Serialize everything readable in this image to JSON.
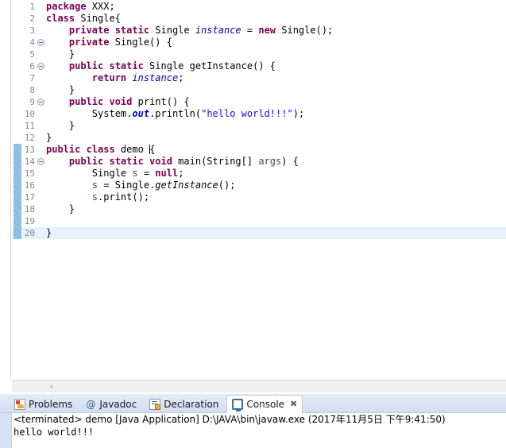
{
  "editor": {
    "name": "java-code-editor",
    "current_line": 20,
    "caret_line": 13,
    "changed_lines_from": 13,
    "changed_lines_to": 20,
    "horizontal_scroll_arrow": "‹",
    "lines": [
      {
        "num": "1",
        "fold": false,
        "changed": false,
        "current": false,
        "tokens": [
          {
            "t": "kw",
            "v": "package"
          },
          {
            "t": "plain",
            "v": " XXX;"
          }
        ]
      },
      {
        "num": "2",
        "fold": false,
        "changed": false,
        "current": false,
        "tokens": [
          {
            "t": "kw",
            "v": "class"
          },
          {
            "t": "plain",
            "v": " Single{"
          }
        ]
      },
      {
        "num": "3",
        "fold": false,
        "changed": false,
        "current": false,
        "tokens": [
          {
            "t": "plain",
            "v": "    "
          },
          {
            "t": "kw",
            "v": "private static"
          },
          {
            "t": "plain",
            "v": " Single "
          },
          {
            "t": "fld",
            "v": "instance"
          },
          {
            "t": "plain",
            "v": " = "
          },
          {
            "t": "kw",
            "v": "new"
          },
          {
            "t": "plain",
            "v": " Single();"
          }
        ]
      },
      {
        "num": "4",
        "fold": true,
        "changed": false,
        "current": false,
        "tokens": [
          {
            "t": "plain",
            "v": "    "
          },
          {
            "t": "kw",
            "v": "private"
          },
          {
            "t": "plain",
            "v": " Single() {"
          }
        ]
      },
      {
        "num": "5",
        "fold": false,
        "changed": false,
        "current": false,
        "tokens": [
          {
            "t": "plain",
            "v": "    }"
          }
        ]
      },
      {
        "num": "6",
        "fold": true,
        "changed": false,
        "current": false,
        "tokens": [
          {
            "t": "plain",
            "v": "    "
          },
          {
            "t": "kw",
            "v": "public static"
          },
          {
            "t": "plain",
            "v": " Single getInstance() {"
          }
        ]
      },
      {
        "num": "7",
        "fold": false,
        "changed": false,
        "current": false,
        "tokens": [
          {
            "t": "plain",
            "v": "        "
          },
          {
            "t": "kw",
            "v": "return"
          },
          {
            "t": "plain",
            "v": " "
          },
          {
            "t": "fld",
            "v": "instance"
          },
          {
            "t": "plain",
            "v": ";"
          }
        ]
      },
      {
        "num": "8",
        "fold": false,
        "changed": false,
        "current": false,
        "tokens": [
          {
            "t": "plain",
            "v": "    }"
          }
        ]
      },
      {
        "num": "9",
        "fold": true,
        "changed": false,
        "current": false,
        "tokens": [
          {
            "t": "plain",
            "v": "    "
          },
          {
            "t": "kw",
            "v": "public void"
          },
          {
            "t": "plain",
            "v": " print() {"
          }
        ]
      },
      {
        "num": "10",
        "fold": false,
        "changed": false,
        "current": false,
        "tokens": [
          {
            "t": "plain",
            "v": "        System."
          },
          {
            "t": "sfld",
            "v": "out"
          },
          {
            "t": "plain",
            "v": ".println("
          },
          {
            "t": "str",
            "v": "\"hello world!!!\""
          },
          {
            "t": "plain",
            "v": ");"
          }
        ]
      },
      {
        "num": "11",
        "fold": false,
        "changed": false,
        "current": false,
        "tokens": [
          {
            "t": "plain",
            "v": "    }"
          }
        ]
      },
      {
        "num": "12",
        "fold": false,
        "changed": false,
        "current": false,
        "tokens": [
          {
            "t": "plain",
            "v": "}"
          }
        ]
      },
      {
        "num": "13",
        "fold": false,
        "changed": true,
        "current": false,
        "caret_at_end": true,
        "tokens": [
          {
            "t": "kw",
            "v": "public class"
          },
          {
            "t": "plain",
            "v": " demo "
          },
          {
            "t": "plain",
            "v": "{"
          }
        ]
      },
      {
        "num": "14",
        "fold": true,
        "changed": true,
        "current": false,
        "tokens": [
          {
            "t": "plain",
            "v": "    "
          },
          {
            "t": "kw",
            "v": "public static void"
          },
          {
            "t": "plain",
            "v": " main(String[] "
          },
          {
            "t": "lvar",
            "v": "args"
          },
          {
            "t": "plain",
            "v": ") {"
          }
        ]
      },
      {
        "num": "15",
        "fold": false,
        "changed": true,
        "current": false,
        "tokens": [
          {
            "t": "plain",
            "v": "        Single "
          },
          {
            "t": "lvar",
            "v": "s"
          },
          {
            "t": "plain",
            "v": " = "
          },
          {
            "t": "kw",
            "v": "null"
          },
          {
            "t": "plain",
            "v": ";"
          }
        ]
      },
      {
        "num": "16",
        "fold": false,
        "changed": true,
        "current": false,
        "tokens": [
          {
            "t": "plain",
            "v": "        "
          },
          {
            "t": "lvar",
            "v": "s"
          },
          {
            "t": "plain",
            "v": " = Single."
          },
          {
            "t": "smeth",
            "v": "getInstance"
          },
          {
            "t": "plain",
            "v": "();"
          }
        ]
      },
      {
        "num": "17",
        "fold": false,
        "changed": true,
        "current": false,
        "tokens": [
          {
            "t": "plain",
            "v": "        "
          },
          {
            "t": "lvar",
            "v": "s"
          },
          {
            "t": "plain",
            "v": ".print();"
          }
        ]
      },
      {
        "num": "18",
        "fold": false,
        "changed": true,
        "current": false,
        "tokens": [
          {
            "t": "plain",
            "v": "    }"
          }
        ]
      },
      {
        "num": "19",
        "fold": false,
        "changed": true,
        "current": false,
        "tokens": [
          {
            "t": "plain",
            "v": ""
          }
        ]
      },
      {
        "num": "20",
        "fold": false,
        "changed": true,
        "current": true,
        "tokens": [
          {
            "t": "plain",
            "v": "}"
          }
        ]
      }
    ]
  },
  "bottom_panel": {
    "tabs": [
      {
        "label": "Problems",
        "icon": "problems-icon",
        "active": false,
        "closeable": false
      },
      {
        "label": "Javadoc",
        "icon": "javadoc-icon",
        "active": false,
        "closeable": false
      },
      {
        "label": "Declaration",
        "icon": "declaration-icon",
        "active": false,
        "closeable": false
      },
      {
        "label": "Console",
        "icon": "console-icon",
        "active": true,
        "closeable": true
      }
    ],
    "close_glyph": "✖",
    "console": {
      "header": "<terminated> demo [Java Application] D:\\JAVA\\bin\\javaw.exe (2017年11月5日 下午9:41:50)",
      "output": [
        "hello world!!!"
      ]
    }
  },
  "colors": {
    "keyword": "#7f0055",
    "string": "#2a00ff",
    "field": "#0000c0",
    "local_var": "#6a3e3e",
    "line_number": "#888888",
    "current_line_bg": "#e8f2fb",
    "change_bar": "#6ba9d8",
    "tab_bar_bg": "#d7e3f2",
    "editor_bg": "#ffffff"
  }
}
